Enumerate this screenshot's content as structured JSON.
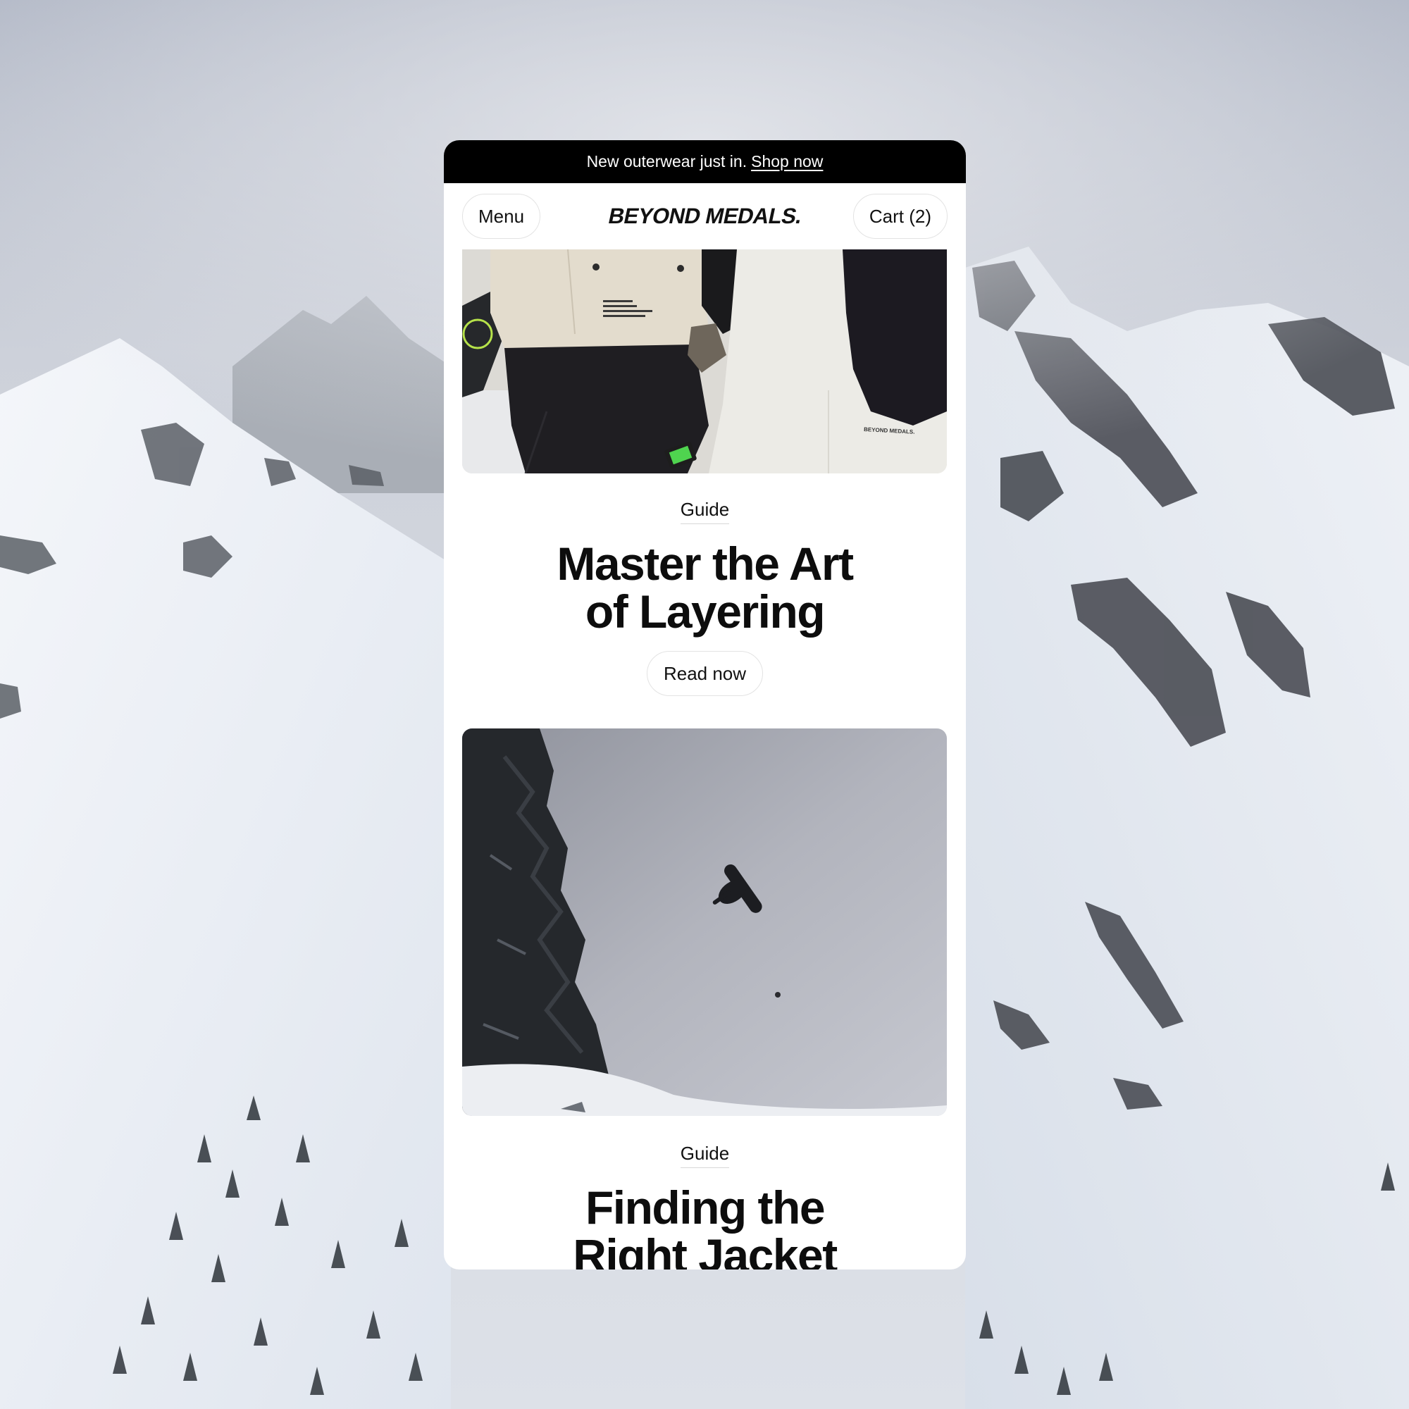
{
  "announcement": {
    "text": "New outerwear just in.",
    "link": "Shop now"
  },
  "header": {
    "menu_label": "Menu",
    "logo": "BEYOND MEDALS.",
    "cart_label": "Cart (2)"
  },
  "articles": [
    {
      "image": "outerwear-closeup-photo",
      "jacket_print": "BEYOND MEDALS.",
      "tag": "Guide",
      "title_line1": "Master the Art",
      "title_line2": "of Layering",
      "cta": "Read now"
    },
    {
      "image": "snowboarder-jump-photo",
      "tag": "Guide",
      "title_line1": "Finding the",
      "title_line2": "Right Jacket"
    }
  ],
  "colors": {
    "announce_bg": "#000000",
    "page_bg": "#ffffff",
    "text": "#0d0d0d",
    "pill_border": "#e3e3e3"
  }
}
